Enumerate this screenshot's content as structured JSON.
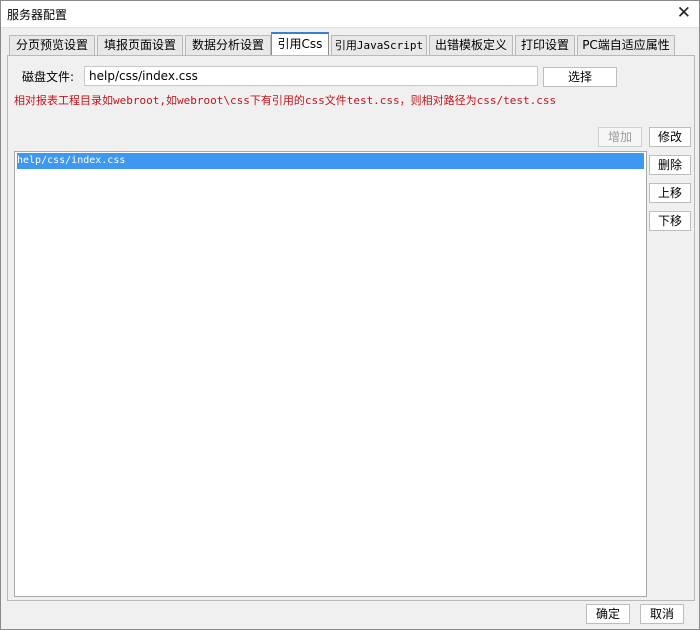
{
  "window": {
    "title": "服务器配置",
    "close_symbol": "✕"
  },
  "tabs": [
    {
      "label": "分页预览设置",
      "active": false
    },
    {
      "label": "填报页面设置",
      "active": false
    },
    {
      "label": "数据分析设置",
      "active": false
    },
    {
      "label": "引用Css",
      "active": true
    },
    {
      "label": "引用JavaScript",
      "active": false
    },
    {
      "label": "出错模板定义",
      "active": false
    },
    {
      "label": "打印设置",
      "active": false
    },
    {
      "label": "PC端自适应属性",
      "active": false
    }
  ],
  "css_panel": {
    "file_label": "磁盘文件:",
    "file_value": "help/css/index.css",
    "choose_button": "选择",
    "hint": "相对报表工程目录如webroot,如webroot\\css下有引用的css文件test.css，则相对路径为css/test.css",
    "add_button": "增加",
    "edit_button": "修改",
    "delete_button": "删除",
    "move_up_button": "上移",
    "move_down_button": "下移",
    "css_list": [
      "help/css/index.css"
    ]
  },
  "footer": {
    "ok_button": "确定",
    "cancel_button": "取消"
  }
}
